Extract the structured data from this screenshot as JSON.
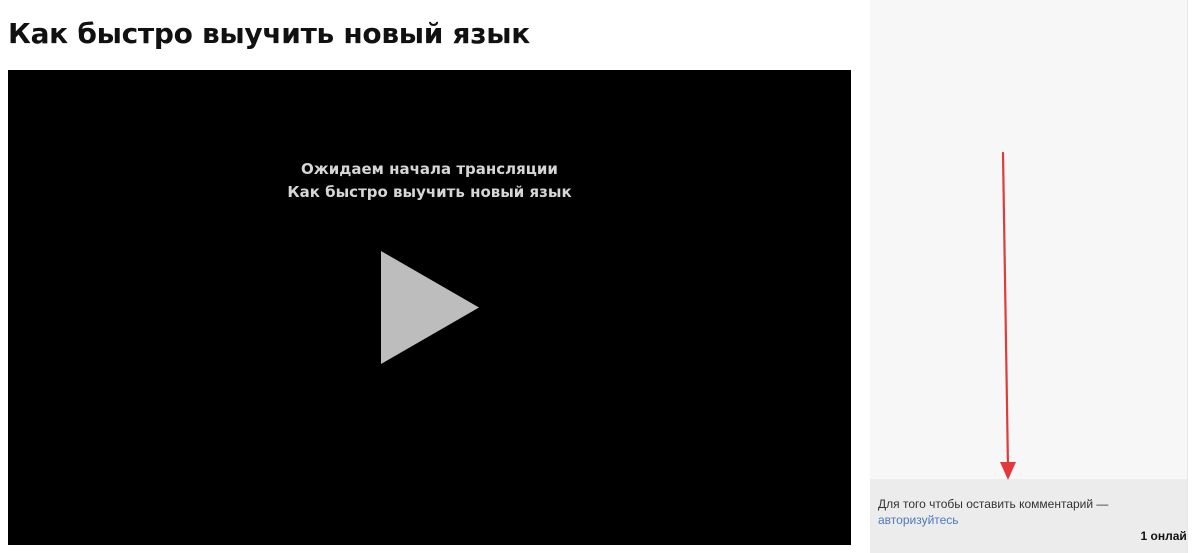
{
  "page": {
    "title": "Как быстро выучить новый язык"
  },
  "player": {
    "status_line1": "Ожидаем начала трансляции",
    "status_line2": "Как быстро выучить новый язык",
    "play_icon": "play-icon"
  },
  "comments": {
    "prompt_text": "Для того чтобы оставить комментарий —",
    "login_link": "авторизуйтесь",
    "online_count": "1 онлайн"
  },
  "annotation": {
    "arrow_icon": "arrow-down-icon",
    "arrow_color": "#e03a3a"
  },
  "colors": {
    "link": "#4f79b8",
    "player_bg": "#000000",
    "play_triangle": "#bdbdbd"
  }
}
